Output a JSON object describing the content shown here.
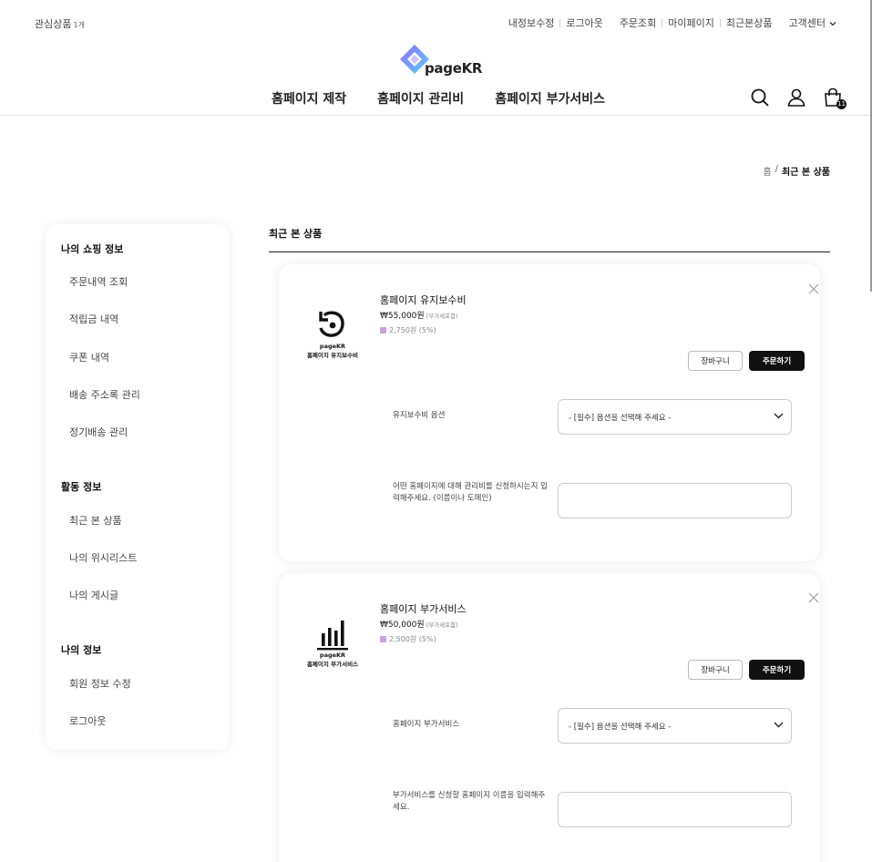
{
  "topbar": {
    "wishlist_label": "관심상품",
    "wishlist_count": "1개",
    "links": [
      "내정보수정",
      "로그아웃",
      "주문조회",
      "마이페이지",
      "최근본상품",
      "고객센터"
    ]
  },
  "logo": {
    "text": "pageKR"
  },
  "nav": {
    "items": [
      "홈페이지 제작",
      "홈페이지 관리비",
      "홈페이지 부가서비스"
    ],
    "cart_count": "11"
  },
  "breadcrumb": {
    "home": "홈",
    "separator": "/",
    "current": "최근 본 상품"
  },
  "sidebar": {
    "sections": [
      {
        "title": "나의 쇼핑 정보",
        "items": [
          "주문내역 조회",
          "적립금 내역",
          "쿠폰 내역",
          "배송 주소록 관리",
          "정기배송 관리"
        ]
      },
      {
        "title": "활동 정보",
        "items": [
          "최근 본 상품",
          "나의 위시리스트",
          "나의 게시글"
        ]
      },
      {
        "title": "나의 정보",
        "items": [
          "회원 정보 수정",
          "로그아웃"
        ]
      }
    ]
  },
  "content": {
    "title": "최근 본 상품",
    "cart_button": "장바구니",
    "order_button": "주문하기",
    "products": [
      {
        "name": "홈페이지 유지보수비",
        "price": "₩55,000원",
        "vat": "(부가세포함)",
        "point": "2,750원 (5%)",
        "thumb_brand": "pageKR",
        "thumb_caption": "홈페이지 유지보수비",
        "thumb_icon": "refresh-icon",
        "option_label": "유지보수비 옵션",
        "option_value": "- [필수] 옵션을 선택해 주세요 -",
        "input_label": "어떤 홈페이지에 대해 관리비를 신청하시는지 입력해주세요. (이름이나 도메인)"
      },
      {
        "name": "홈페이지 부가서비스",
        "price": "₩50,000원",
        "vat": "(부가세포함)",
        "point": "2,500원 (5%)",
        "thumb_brand": "pageKR",
        "thumb_caption": "홈페이지 부가서비스",
        "thumb_icon": "bar-chart-icon",
        "option_label": "홈페이지 부가서비스",
        "option_value": "- [필수] 옵션을 선택해 주세요 -",
        "input_label": "부가서비스를 신청할 홈페이지 이름을 입력해주세요."
      }
    ]
  },
  "colors": {
    "primary": "#111111",
    "border": "#cccccc",
    "point_icon": "#c7a4e0",
    "logo_gradient": [
      "#7c5cff",
      "#5ad1f5"
    ]
  }
}
